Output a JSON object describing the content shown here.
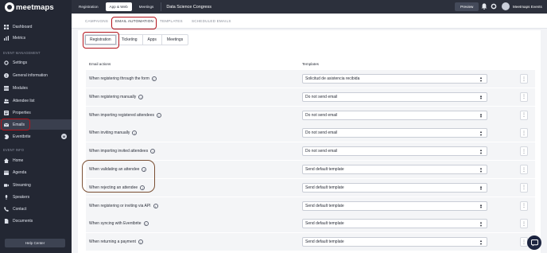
{
  "brand": {
    "logo_text": "meetmaps"
  },
  "sidebar": {
    "top_items": [
      {
        "label": "Dashboard",
        "icon": "dashboard-icon"
      },
      {
        "label": "Metrics",
        "icon": "metrics-icon"
      }
    ],
    "section_event_management": "EVENT MANAGEMENT",
    "management_items": [
      {
        "label": "Settings",
        "icon": "gear-icon"
      },
      {
        "label": "General information",
        "icon": "info-icon"
      },
      {
        "label": "Modules",
        "icon": "modules-icon"
      },
      {
        "label": "Attendee list",
        "icon": "attendees-icon"
      },
      {
        "label": "Properties",
        "icon": "properties-icon"
      },
      {
        "label": "Emails",
        "icon": "mail-icon"
      },
      {
        "label": "Eventbrite",
        "icon": "eventbrite-icon",
        "badge": "M"
      }
    ],
    "section_event_info": "EVENT INFO",
    "info_items": [
      {
        "label": "Home",
        "icon": "home-icon"
      },
      {
        "label": "Agenda",
        "icon": "calendar-icon"
      },
      {
        "label": "Streaming",
        "icon": "streaming-icon"
      },
      {
        "label": "Speakers",
        "icon": "microphone-icon"
      },
      {
        "label": "Contact",
        "icon": "contact-icon"
      },
      {
        "label": "Documents",
        "icon": "documents-icon"
      }
    ],
    "help_label": "Help Center"
  },
  "topbar": {
    "tabs": [
      "Registration",
      "App & Web",
      "Meetings"
    ],
    "event_name": "Data Science Congress",
    "preview_label": "Preview",
    "user_name": "Meetmaps Events"
  },
  "section_tabs": [
    "CAMPAIGNS",
    "EMAIL AUTOMATION",
    "TEMPLATES",
    "SCHEDULED EMAILS"
  ],
  "sub_tabs": [
    "Registration",
    "Ticketing",
    "Apps",
    "Meetings"
  ],
  "table": {
    "col_actions": "Email actions",
    "col_templates": "Templates",
    "rows": [
      {
        "action": "When registering through the form",
        "template": "Solicitud de asistencia recibida"
      },
      {
        "action": "When registering manually",
        "template": "Do not send email"
      },
      {
        "action": "When importing registered attendees",
        "template": "Do not send email"
      },
      {
        "action": "When inviting manually",
        "template": "Do not send email"
      },
      {
        "action": "When importing invited attendees",
        "template": "Do not send email"
      },
      {
        "action": "When validating an attendee",
        "template": "Send default template"
      },
      {
        "action": "When rejecting an attendee",
        "template": "Send default template"
      },
      {
        "action": "When registering or inviting via API",
        "template": "Send default template"
      },
      {
        "action": "When syncing with Eventbrite",
        "template": "Send default template"
      },
      {
        "action": "When returning a payment",
        "template": "Send default template"
      }
    ]
  },
  "colors": {
    "sidebar_bg": "#232733",
    "topbar_bg": "#2c303c",
    "annotation_red": "#b3121b",
    "annotation_brown": "#7a4f33"
  }
}
